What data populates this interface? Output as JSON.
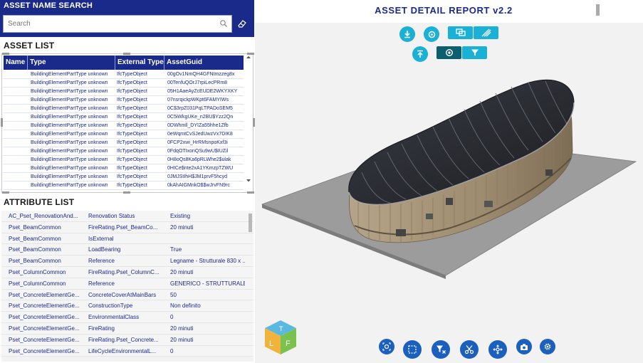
{
  "search": {
    "title": "ASSET NAME SEARCH",
    "placeholder": "Search"
  },
  "asset_list": {
    "title": "ASSET LIST",
    "columns": [
      "Name",
      "Type",
      "External Type",
      "AssetGuid"
    ],
    "rows": [
      [
        "",
        "BuildingElementPartType unknown",
        "IfcTypeObject",
        "00gOv1NmQH4GFNtmzzeg8x"
      ],
      [
        "",
        "BuildingElementPartType unknown",
        "IfcTypeObject",
        "00TenfuQOrJ7rpiLecPRm8"
      ],
      [
        "",
        "BuildingElementPartType unknown",
        "IfcTypeObject",
        "05H1AaeAyZcEUDE2WKYXKY"
      ],
      [
        "",
        "BuildingElementPartType unknown",
        "IfcTypeObject",
        "07nsrqickpWKpt6FAMYIWs"
      ],
      [
        "",
        "BuildingElementPartType unknown",
        "IfcTypeObject",
        "0C$3rpZ031PqLTPADoSEM5"
      ],
      [
        "",
        "BuildingElementPartType unknown",
        "IfcTypeObject",
        "0C5iWkgUKe_n2BU$Yzz2Qn"
      ],
      [
        "",
        "BuildingElementPartType unknown",
        "IfcTypeObject",
        "0DWhmll_DYIZa55hhe1Zfb"
      ],
      [
        "",
        "BuildingElementPartType unknown",
        "IfcTypeObject",
        "0eWqmtCvSJedUwzVx7DIK8"
      ],
      [
        "",
        "BuildingElementPartType unknown",
        "IfcTypeObject",
        "0FCP2xwi_HrRMsnpoKxf3i"
      ],
      [
        "",
        "BuildingElementPartType unknown",
        "IfcTypeObject",
        "0FdqOTIxonQSu9wU$IUZil"
      ],
      [
        "",
        "BuildingElementPartType unknown",
        "IfcTypeObject",
        "0H8oQs8Ka6pRLWhe2$ulak"
      ],
      [
        "",
        "BuildingElementPartType unknown",
        "IfcTypeObject",
        "0HICe$nte2xA1YKmzpTZWU"
      ],
      [
        "",
        "BuildingElementPartType unknown",
        "IfcTypeObject",
        "0JMJStIhH$JM1prvF5hcyd"
      ],
      [
        "",
        "BuildingElementPartType unknown",
        "IfcTypeObject",
        "0kAhAIGMnkO$$wJrvFN9rc"
      ]
    ]
  },
  "attribute_list": {
    "title": "ATTRIBUTE LIST",
    "rows": [
      [
        "AC_Pset_RenovationAnd...",
        "Renovation Status",
        "Existing"
      ],
      [
        "Pset_BeamCommon",
        "FireRating.Pset_BeamCo...",
        "20 minuti"
      ],
      [
        "Pset_BeamCommon",
        "IsExternal",
        ""
      ],
      [
        "Pset_BeamCommon",
        "LoadBearing",
        "True"
      ],
      [
        "Pset_BeamCommon",
        "Reference",
        "Legname - Strutturale 830 x ..."
      ],
      [
        "Pset_ColumnCommon",
        "FireRating.Pset_ColumnC...",
        "20 minuti"
      ],
      [
        "Pset_ColumnCommon",
        "Reference",
        "GENERICO - STRUTTURALE ..."
      ],
      [
        "Pset_ConcreteElementGe...",
        "ConcreteCoverAtMainBars",
        "50"
      ],
      [
        "Pset_ConcreteElementGe...",
        "ConstructionType",
        "Non definito"
      ],
      [
        "Pset_ConcreteElementGe...",
        "EnvironmentalClass",
        "0"
      ],
      [
        "Pset_ConcreteElementGe...",
        "FireRating",
        "20 minuti"
      ],
      [
        "Pset_ConcreteElementGe...",
        "FireRating.Pset_Concrete...",
        "20 minuti"
      ],
      [
        "Pset_ConcreteElementGe...",
        "LifeCycleEnvironmentalL...",
        "0"
      ]
    ]
  },
  "report": {
    "title": "ASSET DETAIL REPORT v2.2"
  },
  "viewer": {
    "top_toolbar_icons": [
      "download-icon",
      "target-icon",
      "copy-icon",
      "hatch-icon",
      "upload-icon",
      "orbit-icon",
      "filter-icon"
    ],
    "bottom_toolbar_icons": [
      "focus-icon",
      "select-box-icon",
      "clear-filter-icon",
      "cut-icon",
      "move-icon",
      "camera-icon",
      "settings-icon"
    ],
    "logo_letters": [
      "T",
      "L",
      "F"
    ]
  },
  "colors": {
    "header_blue": "#1a2a8a",
    "toolbar_cyan": "#1bb0d6",
    "toolbar_dark": "#0c5f6e",
    "bottom_blue": "#1b5fbf"
  }
}
